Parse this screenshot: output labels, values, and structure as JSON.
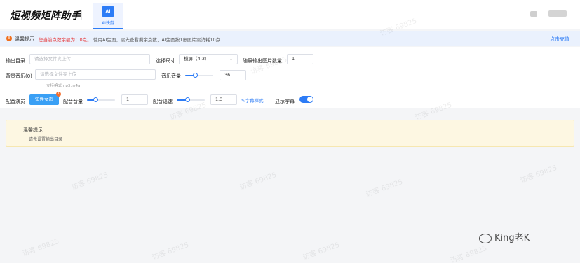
{
  "header": {
    "logo": "短视频矩阵助手",
    "tab_label": "AI快剪",
    "tab_icon": "AI"
  },
  "notice": {
    "title": "温馨提示",
    "red_text": "您当前点数余额为：0点。",
    "text": "使用AI生图，需先查看剩余点数，AI生图按1张图片需消耗10点",
    "link": "点击充值"
  },
  "form": {
    "output_dir_label": "输出目录",
    "output_dir_placeholder": "请选择文件夹上传",
    "size_label": "选择尺寸",
    "size_value": "横屏（4:3）",
    "count_label": "随屏输出图片数量",
    "count_value": "1",
    "bgm_label": "背景音乐(0)",
    "bgm_placeholder": "请选择文件夹上传",
    "bgm_hint": "支持格式mp3,m4a",
    "music_volume_label": "音乐音量",
    "music_volume_value": "36",
    "voice_label": "配音演员",
    "voice_button": "知性女声",
    "voice_badge": "1",
    "voice_volume_label": "配音音量",
    "voice_volume_value": "1",
    "voice_speed_label": "配音语速",
    "voice_speed_value": "1.3",
    "subtitle_style_link": "✎字幕样式",
    "show_subtitle_label": "显示字幕",
    "show_subtitle_on": true
  },
  "warning": {
    "title": "温馨提示",
    "text": "请先设置输出目录"
  },
  "watermark": {
    "text": "访客 69825",
    "wechat": "King老K"
  }
}
